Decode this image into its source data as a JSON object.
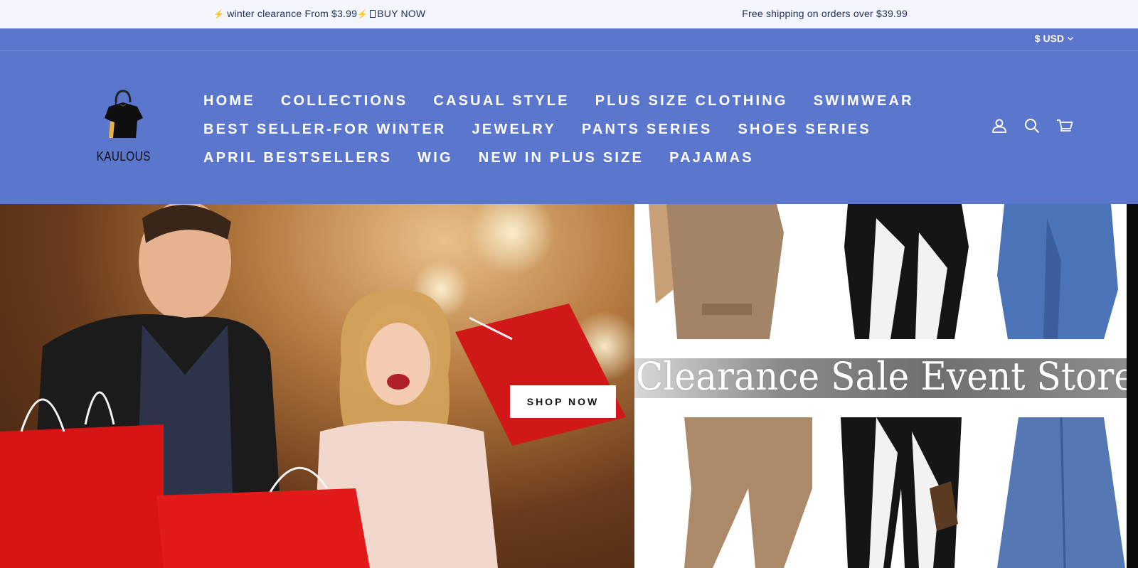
{
  "announcement": {
    "promo_text": "winter clearance From $3.99",
    "promo_cta": "BUY NOW",
    "shipping_text": "Free shipping on orders over $39.99"
  },
  "header": {
    "currency": "$ USD",
    "logo_text": "KAULOUS",
    "nav": [
      [
        "HOME",
        "COLLECTIONS",
        "CASUAL STYLE",
        "PLUS SIZE CLOTHING",
        "SWIMWEAR"
      ],
      [
        "BEST SELLER-FOR WINTER",
        "JEWELRY",
        "PANTS SERIES",
        "SHOES SERIES"
      ],
      [
        "APRIL BESTSELLERS",
        "WIG",
        "NEW IN PLUS SIZE",
        "PAJAMAS"
      ]
    ],
    "icons": [
      "account-icon",
      "search-icon",
      "cart-icon"
    ]
  },
  "hero": {
    "shop_now": "SHOP NOW",
    "banner_text": "Clearance Sale Event Store"
  },
  "colors": {
    "header_bg": "#5b76cd",
    "announce_bg": "#f4f6fd",
    "announce_text": "#1f2f5a"
  }
}
